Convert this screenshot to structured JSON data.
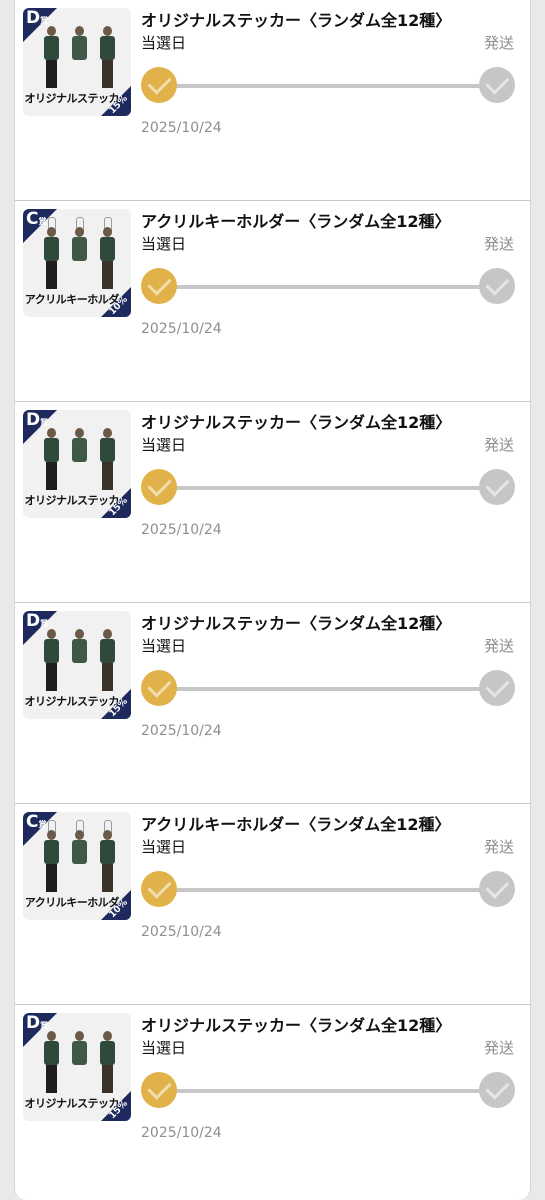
{
  "items": [
    {
      "title": "オリジナルステッカー〈ランダム全12種〉",
      "selected_label": "当選日",
      "shipped_label": "発送",
      "date": "2025/10/24",
      "badge": "D",
      "badge_suffix": "賞",
      "percent": "15%",
      "caption": "オリジナルステッカー",
      "kind": "sticker"
    },
    {
      "title": "アクリルキーホルダー〈ランダム全12種〉",
      "selected_label": "当選日",
      "shipped_label": "発送",
      "date": "2025/10/24",
      "badge": "C",
      "badge_suffix": "賞",
      "percent": "10%",
      "caption": "アクリルキーホルダー",
      "kind": "keychain"
    },
    {
      "title": "オリジナルステッカー〈ランダム全12種〉",
      "selected_label": "当選日",
      "shipped_label": "発送",
      "date": "2025/10/24",
      "badge": "D",
      "badge_suffix": "賞",
      "percent": "15%",
      "caption": "オリジナルステッカー",
      "kind": "sticker"
    },
    {
      "title": "オリジナルステッカー〈ランダム全12種〉",
      "selected_label": "当選日",
      "shipped_label": "発送",
      "date": "2025/10/24",
      "badge": "D",
      "badge_suffix": "賞",
      "percent": "15%",
      "caption": "オリジナルステッカー",
      "kind": "sticker"
    },
    {
      "title": "アクリルキーホルダー〈ランダム全12種〉",
      "selected_label": "当選日",
      "shipped_label": "発送",
      "date": "2025/10/24",
      "badge": "C",
      "badge_suffix": "賞",
      "percent": "10%",
      "caption": "アクリルキーホルダー",
      "kind": "keychain"
    },
    {
      "title": "オリジナルステッカー〈ランダム全12種〉",
      "selected_label": "当選日",
      "shipped_label": "発送",
      "date": "2025/10/24",
      "badge": "D",
      "badge_suffix": "賞",
      "percent": "15%",
      "caption": "オリジナルステッカー",
      "kind": "sticker"
    }
  ],
  "colors": {
    "accent": "#e1b24a",
    "inactive": "#c6c6c6",
    "badge": "#1e2a5e",
    "muted_text": "#8e8e93"
  }
}
